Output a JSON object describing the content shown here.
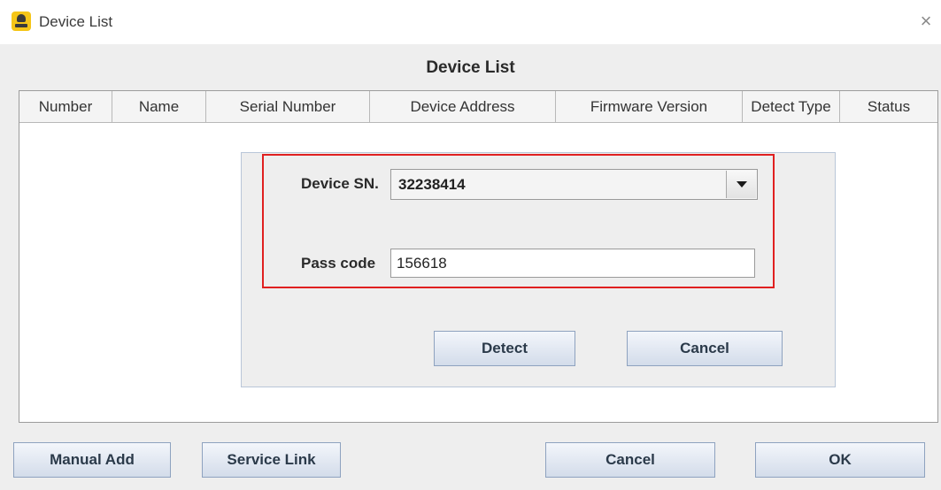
{
  "window": {
    "title": "Device List",
    "close_glyph": "×"
  },
  "list": {
    "title": "Device List",
    "columns": [
      "Number",
      "Name",
      "Serial Number",
      "Device Address",
      "Firmware Version",
      "Detect Type",
      "Status"
    ]
  },
  "popup": {
    "device_sn_label": "Device SN.",
    "device_sn_value": "32238414",
    "pass_code_label": "Pass code",
    "pass_code_value": "156618",
    "detect_label": "Detect",
    "cancel_label": "Cancel"
  },
  "footer": {
    "manual_add_label": "Manual Add",
    "service_link_label": "Service Link",
    "cancel_label": "Cancel",
    "ok_label": "OK"
  },
  "icons": {
    "app": "app-logo-icon",
    "close": "close-icon",
    "dropdown": "chevron-down-icon"
  },
  "colors": {
    "highlight": "#e02020",
    "app_icon": "#f5c518",
    "button_border": "#8ea2bf"
  }
}
